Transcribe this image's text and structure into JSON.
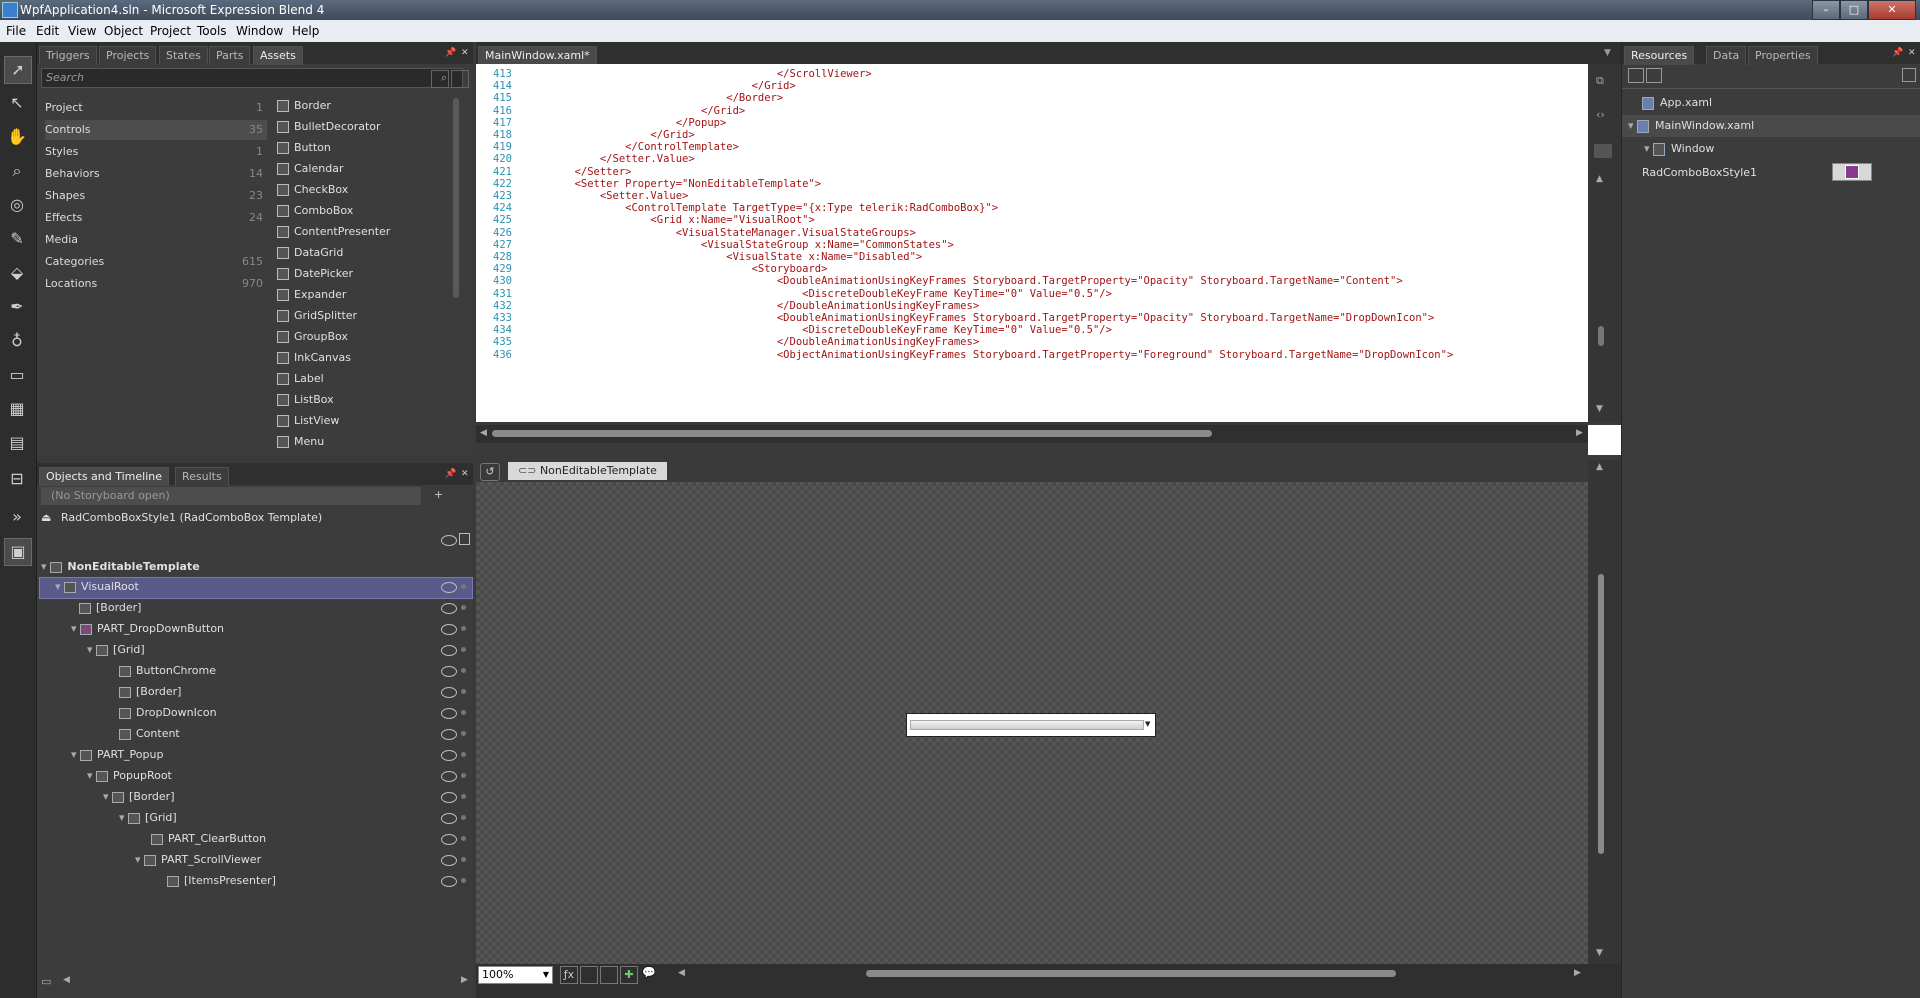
{
  "window": {
    "title": "WpfApplication4.sln - Microsoft Expression Blend 4"
  },
  "menu": [
    "File",
    "Edit",
    "View",
    "Object",
    "Project",
    "Tools",
    "Window",
    "Help"
  ],
  "left_tabs": [
    "Triggers",
    "Projects",
    "States",
    "Parts",
    "Assets"
  ],
  "search_placeholder": "Search",
  "categories": [
    {
      "label": "Project",
      "count": "1"
    },
    {
      "label": "Controls",
      "count": "35"
    },
    {
      "label": "Styles",
      "count": "1"
    },
    {
      "label": "Behaviors",
      "count": "14"
    },
    {
      "label": "Shapes",
      "count": "23"
    },
    {
      "label": "Effects",
      "count": "24"
    },
    {
      "label": "Media",
      "count": ""
    },
    {
      "label": "Categories",
      "count": "615"
    },
    {
      "label": "Locations",
      "count": "970"
    }
  ],
  "assets": [
    "Border",
    "BulletDecorator",
    "Button",
    "Calendar",
    "CheckBox",
    "ComboBox",
    "ContentPresenter",
    "DataGrid",
    "DatePicker",
    "Expander",
    "GridSplitter",
    "GroupBox",
    "InkCanvas",
    "Label",
    "ListBox",
    "ListView",
    "Menu"
  ],
  "objects_tabs": [
    "Objects and Timeline",
    "Results"
  ],
  "storyboard": "(No Storyboard open)",
  "scope": "RadComboBoxStyle1 (RadComboBox Template)",
  "tree": [
    {
      "label": "NonEditableTemplate",
      "indent": 0
    },
    {
      "label": "VisualRoot",
      "indent": 1
    },
    {
      "label": "[Border]",
      "indent": 2
    },
    {
      "label": "PART_DropDownButton",
      "indent": 2
    },
    {
      "label": "[Grid]",
      "indent": 3
    },
    {
      "label": "ButtonChrome",
      "indent": 4
    },
    {
      "label": "[Border]",
      "indent": 4
    },
    {
      "label": "DropDownIcon",
      "indent": 4
    },
    {
      "label": "Content",
      "indent": 4
    },
    {
      "label": "PART_Popup",
      "indent": 2
    },
    {
      "label": "PopupRoot",
      "indent": 3
    },
    {
      "label": "[Border]",
      "indent": 4
    },
    {
      "label": "[Grid]",
      "indent": 5
    },
    {
      "label": "PART_ClearButton",
      "indent": 6
    },
    {
      "label": "PART_ScrollViewer",
      "indent": 6
    },
    {
      "label": "[ItemsPresenter]",
      "indent": 7
    }
  ],
  "editor_tab": "MainWindow.xaml*",
  "code_lines": [
    {
      "n": "413",
      "text": "                                        </ScrollViewer>"
    },
    {
      "n": "414",
      "text": "                                    </Grid>"
    },
    {
      "n": "415",
      "text": "                                </Border>"
    },
    {
      "n": "416",
      "text": "                            </Grid>"
    },
    {
      "n": "417",
      "text": "                        </Popup>"
    },
    {
      "n": "418",
      "text": "                    </Grid>"
    },
    {
      "n": "419",
      "text": "                </ControlTemplate>"
    },
    {
      "n": "420",
      "text": "            </Setter.Value>"
    },
    {
      "n": "421",
      "text": "        </Setter>"
    },
    {
      "n": "422",
      "text": "        <Setter Property=\"NonEditableTemplate\">"
    },
    {
      "n": "423",
      "text": "            <Setter.Value>"
    },
    {
      "n": "424",
      "text": "                <ControlTemplate TargetType=\"{x:Type telerik:RadComboBox}\">"
    },
    {
      "n": "425",
      "text": "                    <Grid x:Name=\"VisualRoot\">"
    },
    {
      "n": "426",
      "text": "                        <VisualStateManager.VisualStateGroups>"
    },
    {
      "n": "427",
      "text": "                            <VisualStateGroup x:Name=\"CommonStates\">"
    },
    {
      "n": "428",
      "text": "                                <VisualState x:Name=\"Disabled\">"
    },
    {
      "n": "429",
      "text": "                                    <Storyboard>"
    },
    {
      "n": "430",
      "text": "                                        <DoubleAnimationUsingKeyFrames Storyboard.TargetProperty=\"Opacity\" Storyboard.TargetName=\"Content\">"
    },
    {
      "n": "431",
      "text": "                                            <DiscreteDoubleKeyFrame KeyTime=\"0\" Value=\"0.5\"/>"
    },
    {
      "n": "432",
      "text": "                                        </DoubleAnimationUsingKeyFrames>"
    },
    {
      "n": "433",
      "text": "                                        <DoubleAnimationUsingKeyFrames Storyboard.TargetProperty=\"Opacity\" Storyboard.TargetName=\"DropDownIcon\">"
    },
    {
      "n": "434",
      "text": "                                            <DiscreteDoubleKeyFrame KeyTime=\"0\" Value=\"0.5\"/>"
    },
    {
      "n": "435",
      "text": "                                        </DoubleAnimationUsingKeyFrames>"
    },
    {
      "n": "436",
      "text": "                                        <ObjectAnimationUsingKeyFrames Storyboard.TargetProperty=\"Foreground\" Storyboard.TargetName=\"DropDownIcon\">"
    }
  ],
  "breadcrumb": "NonEditableTemplate",
  "zoom": "100%",
  "right_tabs": [
    "Resources",
    "Data",
    "Properties"
  ],
  "resources": {
    "app": "App.xaml",
    "main": "MainWindow.xaml",
    "window": "Window",
    "style": "RadComboBoxStyle1"
  },
  "colors": {
    "accent": "#3a7fd0",
    "selection": "#5a5a8a"
  }
}
